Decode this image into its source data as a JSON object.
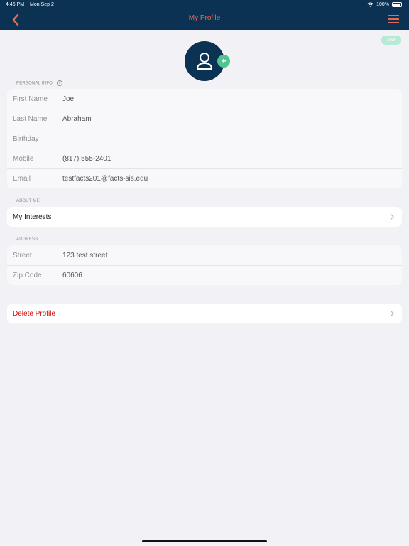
{
  "status_bar": {
    "time": "4:46 PM",
    "date": "Mon Sep 2",
    "battery": "100%"
  },
  "header": {
    "title": "My Profile",
    "accent": "#e06b55",
    "bg": "#0b3153"
  },
  "save_label": "Save",
  "avatar": {
    "icon": "person-icon",
    "add_icon": "plus-icon"
  },
  "personal_info": {
    "label": "PERSONAL INFO",
    "rows": [
      {
        "label": "First Name",
        "value": "Joe"
      },
      {
        "label": "Last Name",
        "value": "Abraham"
      },
      {
        "label": "Birthday",
        "value": ""
      },
      {
        "label": "Mobile",
        "value": "(817) 555-2401"
      },
      {
        "label": "Email",
        "value": "testfacts201@facts-sis.edu"
      }
    ]
  },
  "about_me": {
    "label": "ABOUT ME",
    "interests": "My Interests"
  },
  "address": {
    "label": "ADDRESS",
    "rows": [
      {
        "label": "Street",
        "value": "123 test street"
      },
      {
        "label": "Zip Code",
        "value": "60606"
      }
    ]
  },
  "delete_label": "Delete Profile",
  "colors": {
    "danger": "#d50c0c",
    "add_button": "#4fc48f",
    "save_button": "#b7ead6"
  }
}
